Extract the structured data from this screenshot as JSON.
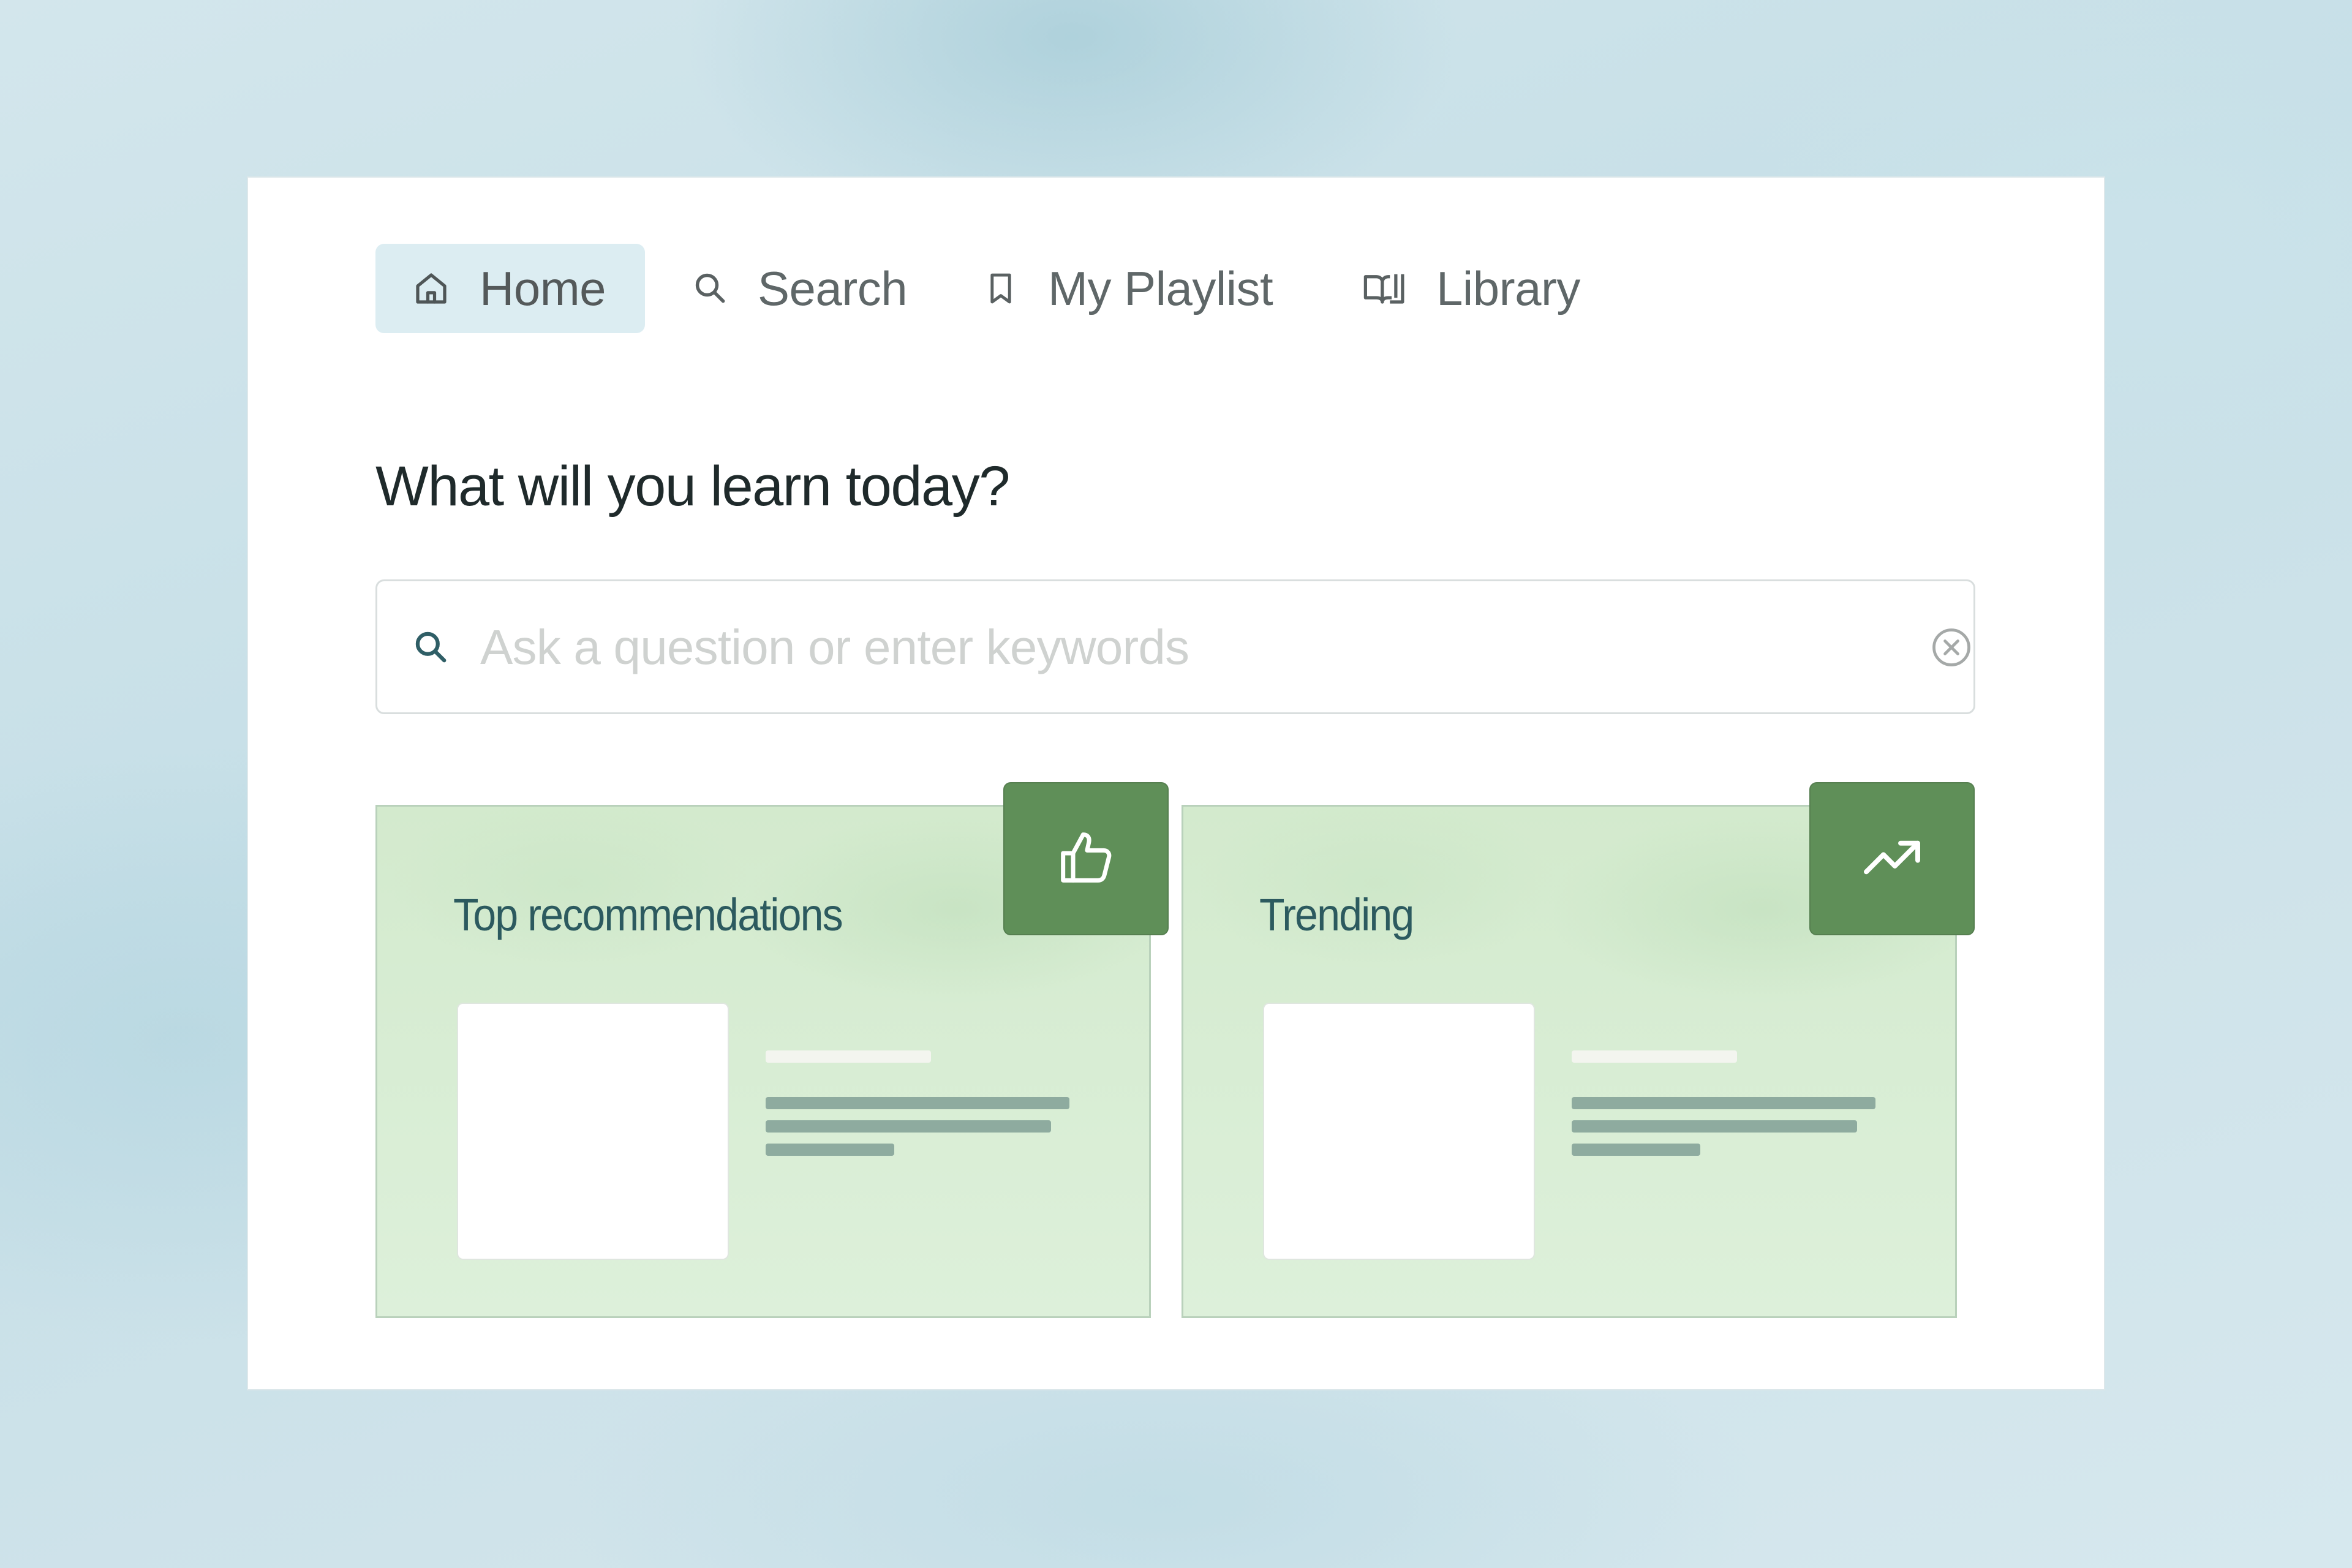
{
  "nav": {
    "items": [
      {
        "label": "Home",
        "icon": "home-icon",
        "active": true
      },
      {
        "label": "Search",
        "icon": "search-icon",
        "active": false
      },
      {
        "label": "My Playlist",
        "icon": "bookmark-icon",
        "active": false
      },
      {
        "label": "Library",
        "icon": "library-book-icon",
        "active": false
      }
    ]
  },
  "main": {
    "heading": "What will you learn today?",
    "search": {
      "placeholder": "Ask a question or enter keywords",
      "value": ""
    },
    "cards": [
      {
        "title": "Top recommendations",
        "badge_icon": "thumbs-up-icon"
      },
      {
        "title": "Trending",
        "badge_icon": "trending-up-icon"
      }
    ]
  },
  "colors": {
    "accent_green": "#5f8f58",
    "card_title": "#2c5a5f",
    "nav_active_bg": "#dcedf2",
    "search_icon": "#2f5e66"
  }
}
